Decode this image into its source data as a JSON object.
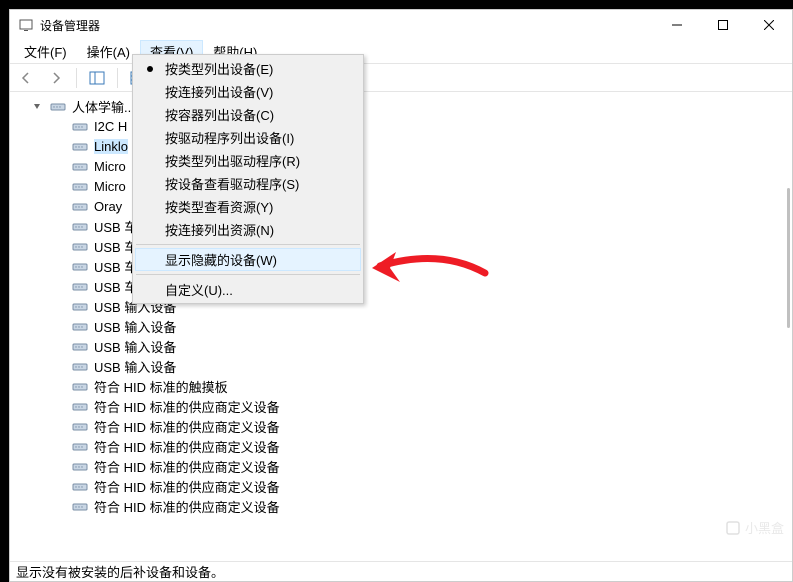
{
  "window": {
    "title": "设备管理器"
  },
  "menubar": {
    "file": "文件(F)",
    "action": "操作(A)",
    "view": "查看(V)",
    "help": "帮助(H)"
  },
  "dropdown": {
    "byType": "按类型列出设备(E)",
    "byConnection": "按连接列出设备(V)",
    "byContainer": "按容器列出设备(C)",
    "driversByDevice": "按驱动程序列出设备(I)",
    "driversByType": "按类型列出驱动程序(R)",
    "viewByDevice": "按设备查看驱动程序(S)",
    "resourcesByType": "按类型查看资源(Y)",
    "resourcesByConn": "按连接列出资源(N)",
    "showHidden": "显示隐藏的设备(W)",
    "customize": "自定义(U)..."
  },
  "tree": {
    "rootCategory": "人体学输...",
    "items": [
      "I2C H",
      "Linklo",
      "Micro",
      "Micro",
      "Oray",
      "USB 车",
      "USB 车",
      "USB 车",
      "USB 车",
      "USB 输入设备",
      "USB 输入设备",
      "USB 输入设备",
      "USB 输入设备",
      "符合 HID 标准的触摸板",
      "符合 HID 标准的供应商定义设备",
      "符合 HID 标准的供应商定义设备",
      "符合 HID 标准的供应商定义设备",
      "符合 HID 标准的供应商定义设备",
      "符合 HID 标准的供应商定义设备",
      "符合 HID 标准的供应商定义设备"
    ],
    "selectedIndex": 1
  },
  "statusbar": {
    "text": "显示没有被安装的后补设备和设备。"
  },
  "watermark": "小黑盒"
}
